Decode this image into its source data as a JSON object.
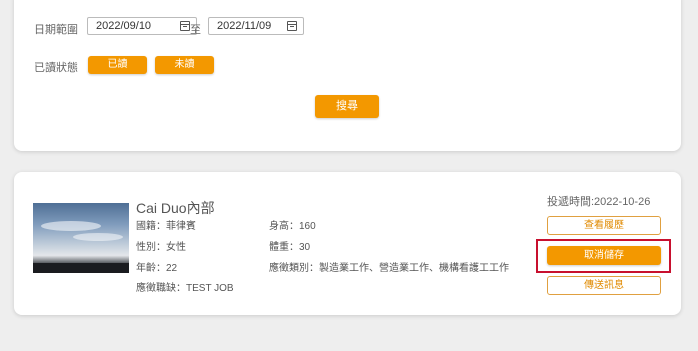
{
  "filter": {
    "date_range_label": "日期範圍",
    "date_from": "2022/09/10",
    "date_sep": "至",
    "date_to": "2022/11/09",
    "read_status_label": "已讀狀態",
    "read_btn": "已讀",
    "unread_btn": "未讀",
    "search_btn": "搜尋"
  },
  "result": {
    "name": "Cai Duo內部",
    "nationality": "國籍：菲律賓",
    "gender": "性別：女性",
    "age": "年齡：22",
    "job": "應徵職缺：TEST JOB",
    "height": "身高：160",
    "weight": "體重：30",
    "categories": "應徵類別：製造業工作、營造業工作、機構看護工工作",
    "sent_time": "投遞時間:2022-10-26",
    "view_resume_btn": "查看履歷",
    "cancel_save_btn": "取消儲存",
    "send_message_btn": "傳送訊息"
  },
  "icons": [
    "calendar-icon"
  ],
  "colors": {
    "accent": "#f39800",
    "highlight": "#c8102e"
  }
}
